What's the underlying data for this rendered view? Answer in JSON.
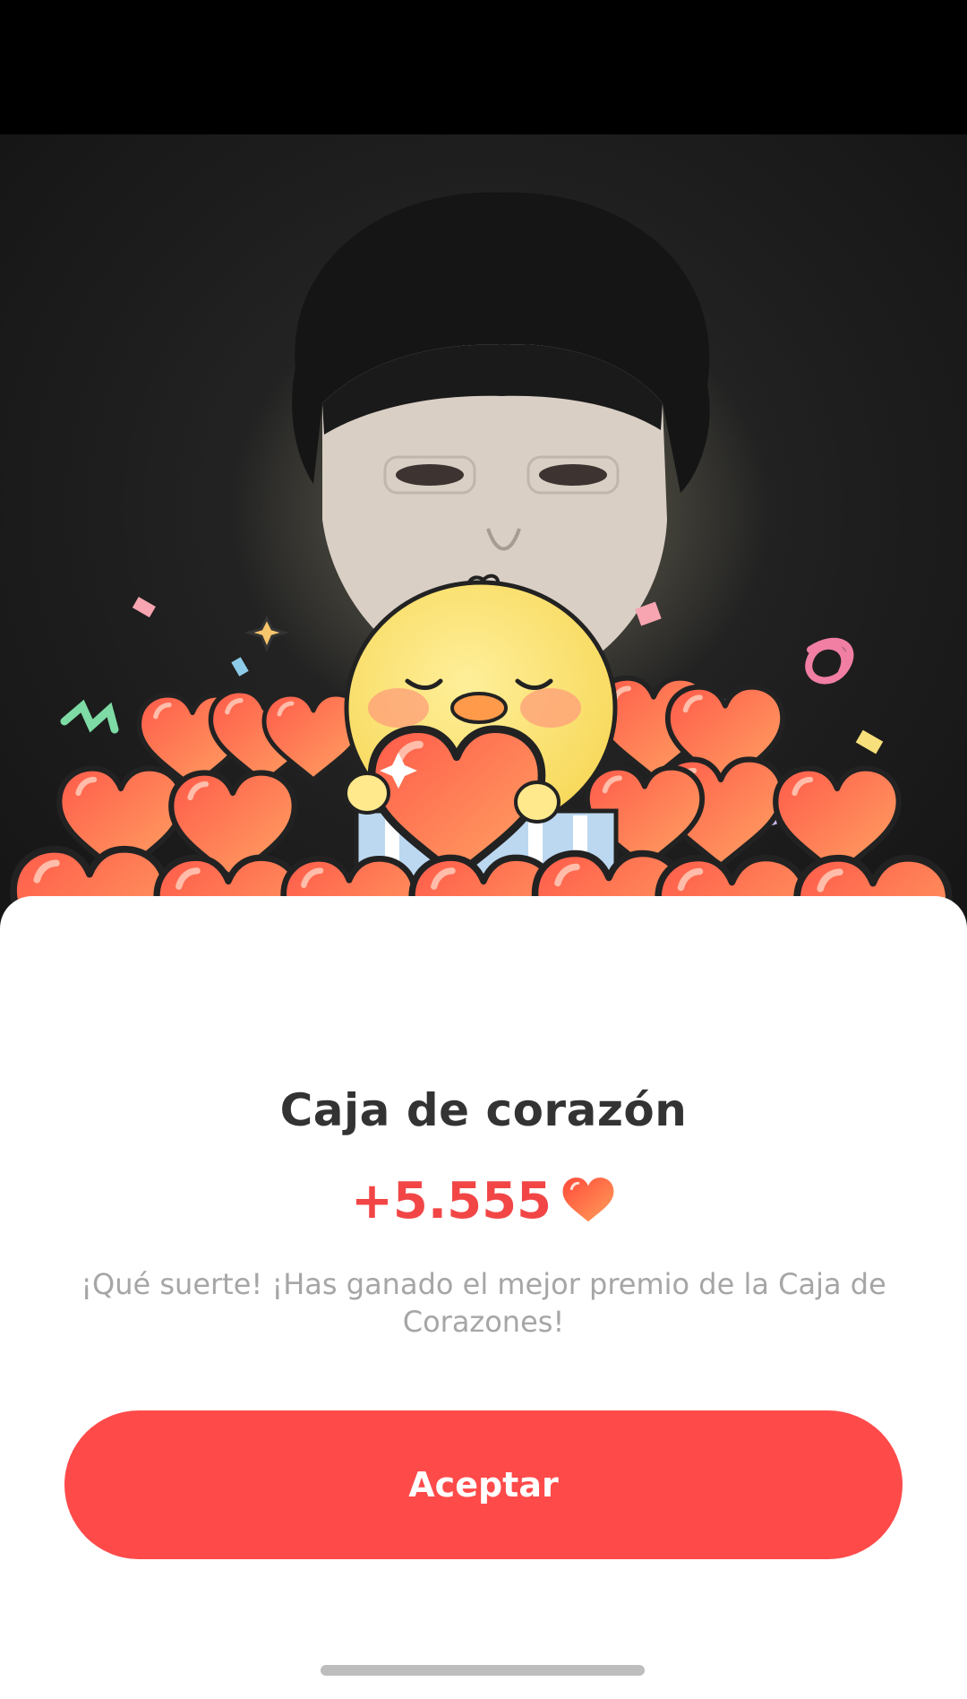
{
  "dialog": {
    "title": "Caja de corazón",
    "reward_amount": "+5.555",
    "reward_icon": "heart-icon",
    "message": "¡Qué suerte! ¡Has ganado el mejor premio de la Caja de Corazones!",
    "accept_label": "Aceptar"
  },
  "colors": {
    "accent": "#ff4a4a",
    "reward_text": "#f24646",
    "title_text": "#333333",
    "message_text": "#a6a6a6"
  }
}
